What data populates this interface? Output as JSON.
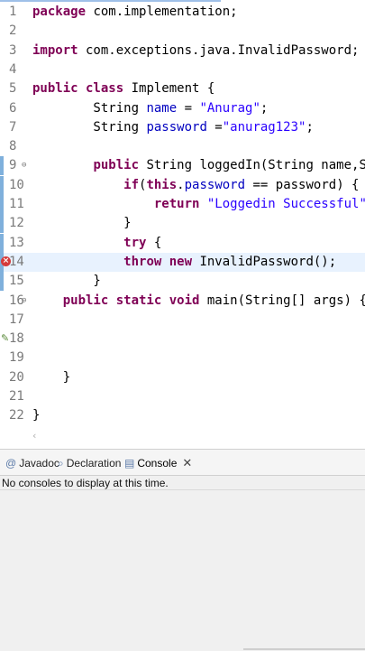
{
  "editor": {
    "lines": [
      {
        "num": "1",
        "segs": [
          {
            "t": "package",
            "c": "kw"
          },
          {
            "t": " com.implementation;",
            "c": ""
          }
        ]
      },
      {
        "num": "2",
        "segs": []
      },
      {
        "num": "3",
        "segs": [
          {
            "t": "import",
            "c": "kw"
          },
          {
            "t": " com.exceptions.java.InvalidPassword;",
            "c": ""
          }
        ]
      },
      {
        "num": "4",
        "segs": []
      },
      {
        "num": "5",
        "segs": [
          {
            "t": "public class",
            "c": "kw"
          },
          {
            "t": " Implement {",
            "c": ""
          }
        ]
      },
      {
        "num": "6",
        "segs": [
          {
            "t": "        String ",
            "c": ""
          },
          {
            "t": "name",
            "c": "fld"
          },
          {
            "t": " = ",
            "c": ""
          },
          {
            "t": "\"Anurag\"",
            "c": "str"
          },
          {
            "t": ";",
            "c": ""
          }
        ]
      },
      {
        "num": "7",
        "segs": [
          {
            "t": "        String ",
            "c": ""
          },
          {
            "t": "password",
            "c": "fld"
          },
          {
            "t": " =",
            "c": ""
          },
          {
            "t": "\"anurag123\"",
            "c": "str"
          },
          {
            "t": ";",
            "c": ""
          }
        ]
      },
      {
        "num": "8",
        "segs": []
      },
      {
        "num": "9",
        "fold": true,
        "segs": [
          {
            "t": "        ",
            "c": ""
          },
          {
            "t": "public",
            "c": "kw"
          },
          {
            "t": " String loggedIn(String name,String p",
            "c": ""
          }
        ]
      },
      {
        "num": "10",
        "segs": [
          {
            "t": "            ",
            "c": ""
          },
          {
            "t": "if",
            "c": "kw"
          },
          {
            "t": "(",
            "c": ""
          },
          {
            "t": "this",
            "c": "kw"
          },
          {
            "t": ".",
            "c": ""
          },
          {
            "t": "password",
            "c": "fld"
          },
          {
            "t": " == password) {",
            "c": ""
          }
        ]
      },
      {
        "num": "11",
        "segs": [
          {
            "t": "                ",
            "c": ""
          },
          {
            "t": "return",
            "c": "kw"
          },
          {
            "t": " ",
            "c": ""
          },
          {
            "t": "\"Loggedin Successful\"",
            "c": "str"
          },
          {
            "t": ";",
            "c": ""
          }
        ]
      },
      {
        "num": "12",
        "segs": [
          {
            "t": "            }",
            "c": ""
          }
        ]
      },
      {
        "num": "13",
        "segs": [
          {
            "t": "            ",
            "c": ""
          },
          {
            "t": "try",
            "c": "kw"
          },
          {
            "t": " {",
            "c": ""
          }
        ]
      },
      {
        "num": "14",
        "error": true,
        "current": true,
        "segs": [
          {
            "t": "            ",
            "c": ""
          },
          {
            "t": "throw new",
            "c": "kw"
          },
          {
            "t": " InvalidPassword();",
            "c": ""
          }
        ]
      },
      {
        "num": "15",
        "segs": [
          {
            "t": "        }",
            "c": ""
          }
        ]
      },
      {
        "num": "16",
        "fold": true,
        "segs": [
          {
            "t": "    ",
            "c": ""
          },
          {
            "t": "public static void",
            "c": "kw"
          },
          {
            "t": " main(String[] args) {",
            "c": ""
          }
        ]
      },
      {
        "num": "17",
        "segs": []
      },
      {
        "num": "18",
        "warn": true,
        "segs": []
      },
      {
        "num": "19",
        "segs": []
      },
      {
        "num": "20",
        "segs": [
          {
            "t": "    }",
            "c": ""
          }
        ]
      },
      {
        "num": "21",
        "segs": []
      },
      {
        "num": "22",
        "segs": [
          {
            "t": "}",
            "c": ""
          }
        ]
      }
    ]
  },
  "console": {
    "tabs": [
      {
        "label": "Javadoc",
        "icon": "@"
      },
      {
        "label": "Declaration",
        "icon": "⌕"
      },
      {
        "label": "Console",
        "icon": "▤"
      }
    ],
    "message": "No consoles to display at this time."
  },
  "colors": {
    "keyword": "#7f0055",
    "field": "#0000c0",
    "string": "#2a00ff",
    "current_line": "#e8f2fe",
    "marker": "#7fb0dc"
  }
}
